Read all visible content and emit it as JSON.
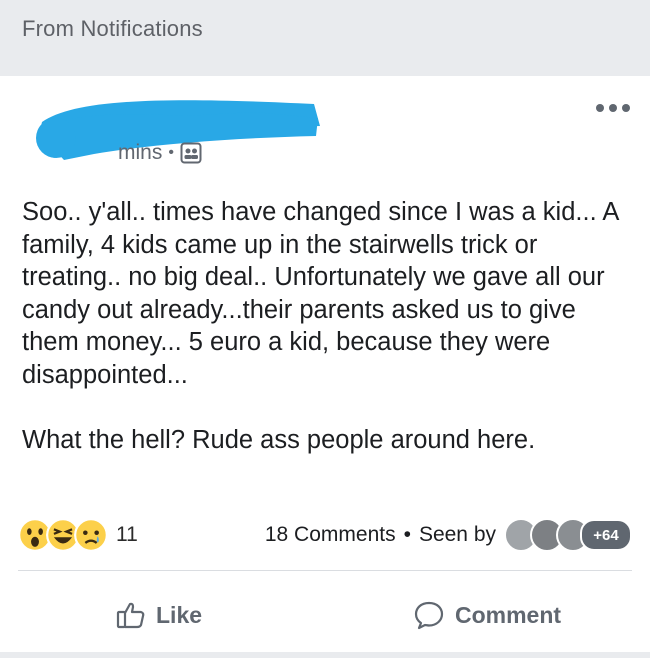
{
  "header": {
    "title": "From Notifications"
  },
  "post": {
    "time_label": "mins",
    "separator": "•",
    "audience_icon": "group-audience-icon",
    "text": "Soo.. y'all.. times have changed since I was a kid... A family, 4 kids came up in the stairwells trick or treating.. no big deal.. Unfortunately we gave all our candy out already...their parents asked us to give them money... 5 euro a kid, because they were disappointed...\n\nWhat the hell? Rude ass people around here.",
    "redaction_color": "#29a8e6"
  },
  "reactions": {
    "icons": [
      "wow-reaction-icon",
      "haha-reaction-icon",
      "sad-reaction-icon"
    ],
    "count": "11"
  },
  "stats": {
    "comments": "18 Comments",
    "separator": "•",
    "seen_by": "Seen by",
    "seen_more": "+64"
  },
  "actions": {
    "like": "Like",
    "comment": "Comment"
  },
  "colors": {
    "accent_gray": "#606770",
    "reaction_yellow": "#fcd04a",
    "header_bg": "#e9ebee"
  }
}
